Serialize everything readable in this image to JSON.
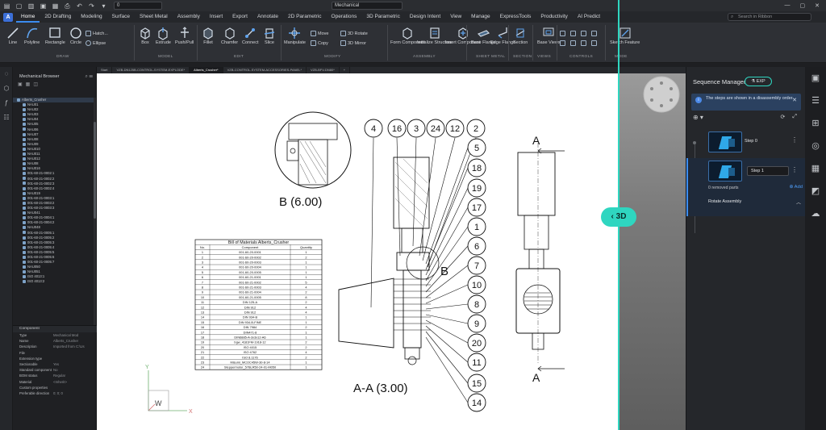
{
  "titlebar": {
    "workspace": "Mechanical",
    "file_field": "0"
  },
  "menu": {
    "items": [
      "Home",
      "2D Drafting",
      "Modeling",
      "Surface",
      "Sheet Metal",
      "Assembly",
      "Insert",
      "Export",
      "Annotate",
      "2D Parametric",
      "Operations",
      "3D Parametric",
      "Design Intent",
      "View",
      "Manage",
      "ExpressTools",
      "Productivity",
      "AI Predict"
    ],
    "search_placeholder": "Search in Ribbon"
  },
  "ribbon": {
    "draw": {
      "line": "Line",
      "polyline": "Polyline",
      "rectangle": "Rectangle",
      "circle": "Circle",
      "hatch": "Hatch...",
      "ellipse": "Ellipse",
      "group": "DRAW"
    },
    "model": {
      "box": "Box",
      "extrude": "Extrude",
      "pushpull": "Push/Pull",
      "group": "MODEL"
    },
    "edit": {
      "fillet": "Fillet",
      "chamfer": "Chamfer",
      "connect": "Connect",
      "slice": "Slice",
      "group": "EDIT"
    },
    "modify": {
      "manipulate": "Manipulate",
      "move": "Move",
      "copy": "Copy",
      "rotate3d": "3D Rotate",
      "mirror3d": "3D Mirror",
      "group": "MODIFY"
    },
    "assembly": {
      "form": "Form Component",
      "init": "Initialize Structure",
      "insert": "Insert Component",
      "group": "ASSEMBLY"
    },
    "sheetmetal": {
      "base": "Base Flange",
      "edge": "Edge Flange",
      "group": "SHEET METAL"
    },
    "section": {
      "section": "Section",
      "group": "SECTION"
    },
    "views": {
      "base": "Base Views",
      "group": "VIEWS"
    },
    "controls": {
      "group": "CONTROLS"
    },
    "mode": {
      "sketch": "Sketch Feature",
      "group": "MODE"
    }
  },
  "browser": {
    "title": "Mechanical Browser",
    "root": "Alberts_Crusher",
    "items": [
      "NAU01",
      "NAU02",
      "NAU03",
      "NAU04",
      "NAU05",
      "NAU06",
      "NAU07",
      "NAU08",
      "NAU09",
      "NAU010",
      "NAU011",
      "NAU012",
      "NAU08",
      "NAU016",
      "001-60-21-0002:1",
      "001-60-21-0002:2",
      "001-60-21-0002:3",
      "001-60-21-0002:4",
      "NAU019",
      "001-60-21-0003:1",
      "001-60-21-0003:2",
      "001-60-21-0003:3",
      "NAU041",
      "001-60-21-0004:1",
      "001-60-21-0004:2",
      "NAU048",
      "001-60-21-0005:1",
      "001-60-21-0005:2",
      "001-60-21-0005:3",
      "001-60-21-0005:4",
      "001-60-21-0005:5",
      "001-60-21-0005:6",
      "001-60-21-0005:7",
      "NAU050",
      "NAU051",
      "ISO 4013:1",
      "ISO 4013:2"
    ]
  },
  "component": {
    "title": "Component",
    "rows": [
      {
        "k": "Type",
        "v": "Mechanical Mod"
      },
      {
        "k": "Name",
        "v": "Alberts_Crusher"
      },
      {
        "k": "Description",
        "v": "Imported from C:\\Us"
      },
      {
        "k": "File",
        "v": ""
      },
      {
        "k": "Extension type",
        "v": ""
      },
      {
        "k": "Sectionable",
        "v": "Yes"
      },
      {
        "k": "Standard component",
        "v": "No"
      },
      {
        "k": "BOM status",
        "v": "Regular"
      },
      {
        "k": "Material",
        "v": "<Inherit>"
      },
      {
        "k": "Custom properties",
        "v": ""
      },
      {
        "k": "Preferable direction",
        "v": "0; 0; 0"
      }
    ]
  },
  "tabs": [
    "Start",
    "VZB-DN125B-CONTROL-SYSTEM-EXPLODE*",
    "Alberts_Crusher*",
    "VZB-CONTROL-SYSTEM-ACCESSORIES-PANEL*",
    "VZB-BFV-DN80*",
    "+"
  ],
  "drawing": {
    "detail_label": "B (6.00)",
    "section_label": "A-A (3.00)",
    "detail_letter": "B",
    "section_letter_top": "A",
    "section_letter_bottom": "A",
    "balloons_top": [
      "4",
      "16",
      "3",
      "24",
      "12",
      "2"
    ],
    "balloons_right": [
      "5",
      "18",
      "19",
      "17",
      "1",
      "6",
      "7",
      "10",
      "8",
      "9",
      "20",
      "11",
      "15",
      "14"
    ],
    "bom": {
      "title": "Bill of Materials Alberts_Crusher",
      "headers": [
        "No.",
        "Component",
        "Quantity"
      ],
      "rows": [
        [
          "1",
          "001-60-20-0001",
          "1"
        ],
        [
          "2",
          "001-60-20-0002",
          "2"
        ],
        [
          "3",
          "001-60-20-0003",
          "1"
        ],
        [
          "4",
          "001-60-20-0004",
          "1"
        ],
        [
          "5",
          "001-60-20-0005",
          "1"
        ],
        [
          "6",
          "001-60-21-0001",
          "1"
        ],
        [
          "7",
          "001-60-21-0002",
          "5"
        ],
        [
          "8",
          "001-60-21-0003",
          "4"
        ],
        [
          "9",
          "001-60-21-0004",
          "2"
        ],
        [
          "10",
          "001-60-21-0005",
          "8"
        ],
        [
          "11",
          "DIN 125-A",
          "2"
        ],
        [
          "12",
          "DIN 912",
          "4"
        ],
        [
          "13",
          "DIN 912",
          "4"
        ],
        [
          "14",
          "DIN 934-B",
          "1"
        ],
        [
          "15",
          "DIN 934-B-FINE",
          "1"
        ],
        [
          "16",
          "DIN 7984",
          "2"
        ],
        [
          "17",
          "DIN471-8",
          "1"
        ],
        [
          "18",
          "DIN6885-A-3x3x12-A6",
          "1"
        ],
        [
          "19",
          "bgw_4181FM-1918-12",
          "2"
        ],
        [
          "20",
          "ISO 4015",
          "2"
        ],
        [
          "21",
          "ISO 4762",
          "4"
        ],
        [
          "22",
          "ISO 8.1176",
          "2"
        ],
        [
          "23",
          "Misumi_MCOC45W-30-8-14",
          "1"
        ],
        [
          "24",
          "Steppermotor_57BLR50-24-01-M050",
          "1"
        ]
      ]
    }
  },
  "split_button": "3D",
  "sequence": {
    "title": "Sequence Manager",
    "exp": "EXP",
    "info": "The steps are shown in a disassembly order.",
    "step0": "Step 0",
    "step1_value": "Step 1",
    "removed": "0 removed parts",
    "add": "Add",
    "rotate": "Rotate Assembly"
  }
}
